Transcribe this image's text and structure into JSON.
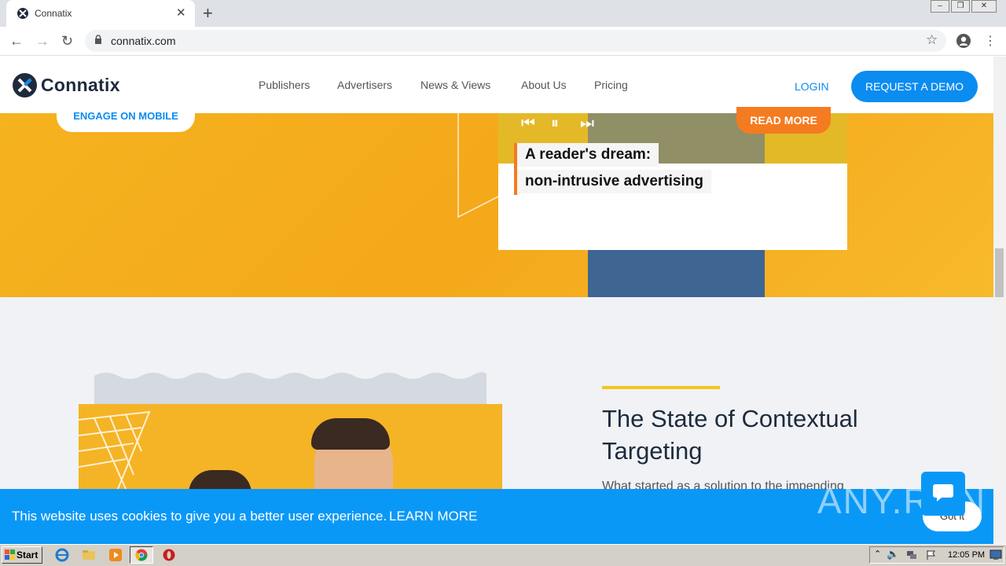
{
  "browser": {
    "tab_title": "Connatix",
    "tab_close": "✕",
    "new_tab": "+",
    "url": "connatix.com"
  },
  "site": {
    "logo": "Connatix",
    "nav": [
      "Publishers",
      "Advertisers",
      "News & Views",
      "About Us",
      "Pricing"
    ],
    "login": "LOGIN",
    "demo": "REQUEST A DEMO"
  },
  "hero": {
    "engage": "ENGAGE ON MOBILE",
    "read_more": "READ MORE",
    "headline_1": "A reader's dream:",
    "headline_2": "non-intrusive advertising"
  },
  "article": {
    "title": "The State of Contextual Targeting",
    "lead": "What started as a solution to the impending"
  },
  "cookie": {
    "text": "This website uses cookies to give you a better user experience.",
    "link": "LEARN MORE",
    "button": "Got it"
  },
  "taskbar": {
    "start": "Start",
    "clock": "12:05 PM"
  },
  "watermark": "ANY.RUN",
  "colors": {
    "brand_blue": "#0a8cf0",
    "hero_yellow": "#f5b31f",
    "accent_orange": "#f47b20",
    "cookie_blue": "#0a98f7"
  }
}
